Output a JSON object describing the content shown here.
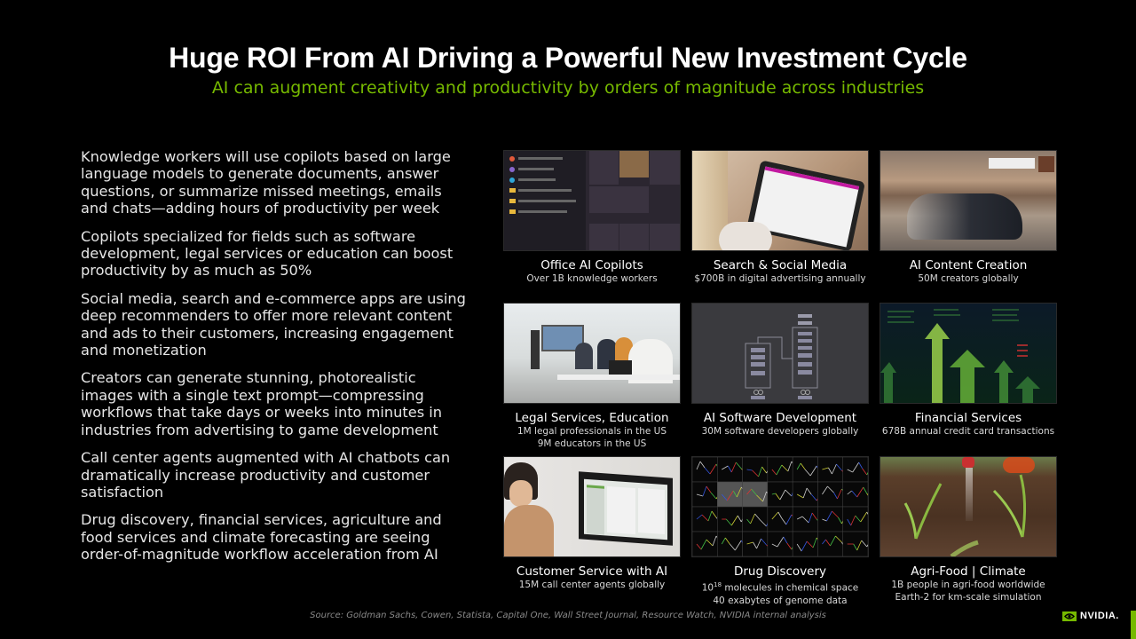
{
  "header": {
    "title": "Huge ROI From AI Driving a Powerful New Investment Cycle",
    "subtitle": "AI can augment creativity and productivity by orders of magnitude across industries"
  },
  "bullets": [
    "Knowledge workers will use copilots based on large language models to generate documents, answer questions, or summarize missed meetings, emails and chats—adding hours of productivity per week",
    "Copilots specialized for fields such as software development, legal services or education can boost productivity by as much as 50%",
    "Social media, search and e-commerce apps are using deep recommenders to offer more relevant content and ads to their customers, increasing engagement and monetization",
    "Creators can generate stunning, photorealistic images with a single text prompt—compressing workflows that take days or weeks into minutes in industries from advertising to game development",
    "Call center agents augmented with AI chatbots can dramatically increase productivity and customer satisfaction",
    "Drug discovery, financial services, agriculture and food services and climate forecasting are seeing order-of-magnitude workflow acceleration from AI"
  ],
  "tiles": [
    {
      "title": "Office AI Copilots",
      "lines": [
        "Over 1B knowledge workers"
      ],
      "image": "windows-start-menu-screenshot"
    },
    {
      "title": "Search & Social Media",
      "lines": [
        "$700B in digital advertising annually"
      ],
      "image": "tablet-shopping-photo"
    },
    {
      "title": "AI Content Creation",
      "lines": [
        "50M creators globally"
      ],
      "image": "generated-car-desert-photo"
    },
    {
      "title": "Legal Services, Education",
      "lines": [
        "1M legal professionals in the US",
        "9M educators in the US"
      ],
      "image": "classroom-photo"
    },
    {
      "title": "AI Software Development",
      "lines": [
        "30M software developers globally"
      ],
      "image": "neural-network-diagram"
    },
    {
      "title": "Financial Services",
      "lines": [
        "678B annual credit card transactions"
      ],
      "image": "stock-market-arrows"
    },
    {
      "title": "Customer Service with AI",
      "lines": [
        "15M call center agents globally"
      ],
      "image": "call-center-agent-photo"
    },
    {
      "title": "Drug Discovery",
      "lines": [
        "10",
        "18",
        " molecules in chemical space",
        "40 exabytes of genome data"
      ],
      "image": "molecule-grid"
    },
    {
      "title": "Agri-Food | Climate",
      "lines": [
        "1B people in agri-food worldwide",
        "Earth-2 for km-scale simulation"
      ],
      "image": "crop-sprayer-photo"
    }
  ],
  "footer": {
    "source": "Source: Goldman Sachs, Cowen, Statista, Capital One, Wall Street Journal, Resource Watch, NVIDIA internal analysis",
    "logo_text": "NVIDIA."
  },
  "colors": {
    "accent": "#76b900",
    "background": "#000000"
  }
}
